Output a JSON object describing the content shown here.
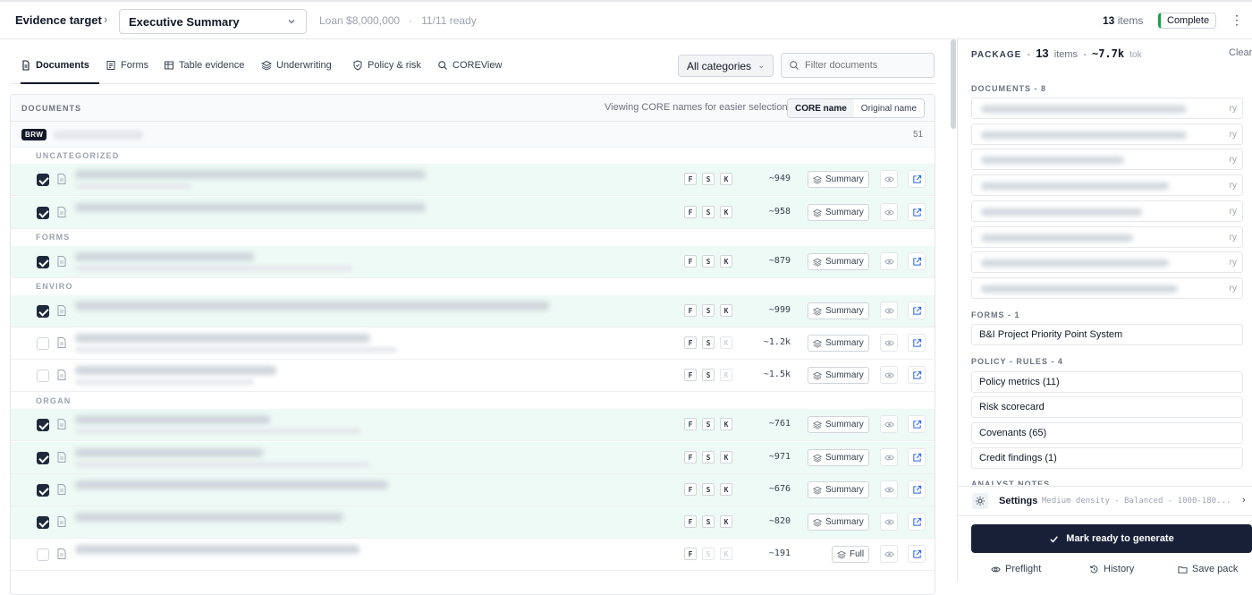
{
  "header": {
    "evidence_label": "Evidence target",
    "target_value": "Executive Summary",
    "loan": "Loan $8,000,000",
    "separator": "·",
    "ready": "11/11 ready",
    "items_count": "13",
    "items_label": "items",
    "status": "Complete"
  },
  "tabs": [
    {
      "label": "Documents",
      "icon": "document-icon"
    },
    {
      "label": "Forms",
      "icon": "form-icon"
    },
    {
      "label": "Table evidence",
      "icon": "table-icon"
    },
    {
      "label": "Underwriting",
      "icon": "layers-icon"
    },
    {
      "label": "Policy & risk",
      "icon": "shield-icon"
    },
    {
      "label": "COREView",
      "icon": "search-icon"
    }
  ],
  "filters": {
    "category": "All categories",
    "search_placeholder": "Filter documents"
  },
  "documents": {
    "title": "DOCUMENTS",
    "viewing_text": "Viewing CORE names for easier selection",
    "toggle": {
      "core": "CORE name",
      "original": "Original name"
    },
    "group_badge": "BRW",
    "group_count": "51",
    "categories": {
      "uncategorized": "UNCATEGORIZED",
      "forms": "FORMS",
      "environmental": "ENVIRO",
      "organization": "ORGAN"
    },
    "flags": [
      "F",
      "S",
      "K"
    ],
    "rows": [
      {
        "checked": true,
        "tokens": "~949",
        "mode": "Summary",
        "k_enabled": true,
        "s_enabled": true
      },
      {
        "checked": true,
        "tokens": "~958",
        "mode": "Summary",
        "k_enabled": true,
        "s_enabled": true
      },
      {
        "checked": true,
        "tokens": "~879",
        "mode": "Summary",
        "k_enabled": true,
        "s_enabled": true
      },
      {
        "checked": true,
        "tokens": "~999",
        "mode": "Summary",
        "k_enabled": true,
        "s_enabled": true
      },
      {
        "checked": false,
        "tokens": "~1.2k",
        "mode": "Summary",
        "k_enabled": false,
        "s_enabled": true
      },
      {
        "checked": false,
        "tokens": "~1.5k",
        "mode": "Summary",
        "k_enabled": false,
        "s_enabled": true
      },
      {
        "checked": true,
        "tokens": "~761",
        "mode": "Summary",
        "k_enabled": true,
        "s_enabled": true
      },
      {
        "checked": true,
        "tokens": "~971",
        "mode": "Summary",
        "k_enabled": true,
        "s_enabled": true
      },
      {
        "checked": true,
        "tokens": "~676",
        "mode": "Summary",
        "k_enabled": true,
        "s_enabled": true
      },
      {
        "checked": true,
        "tokens": "~820",
        "mode": "Summary",
        "k_enabled": true,
        "s_enabled": true
      },
      {
        "checked": false,
        "tokens": "~191",
        "mode": "Full",
        "k_enabled": false,
        "s_enabled": false
      }
    ]
  },
  "package": {
    "label": "PACKAGE",
    "sep": "-",
    "count": "13",
    "items_label": "items",
    "tokens": "~7.7k",
    "tok_label": "tok",
    "clear": "Clear",
    "documents_label": "DOCUMENTS - 8",
    "doc_tag": "ry",
    "forms_label": "FORMS - 1",
    "forms": [
      "B&I Project Priority Point System"
    ],
    "policy_label": "POLICY - RULES - 4",
    "policy": [
      "Policy metrics (11)",
      "Risk scorecard",
      "Covenants (65)",
      "Credit findings (1)"
    ],
    "analyst_label": "ANALYST NOTES"
  },
  "settings": {
    "label": "Settings",
    "value": "Medium density - Balanced - 1000-180..."
  },
  "actions": {
    "mark_ready": "Mark ready to generate",
    "preflight": "Preflight",
    "history": "History",
    "save_pack": "Save pack"
  },
  "colors": {
    "accent_dark": "#172036",
    "checked_row": "#eefaf5",
    "status_green": "#16a34a",
    "link_blue": "#2563eb"
  }
}
